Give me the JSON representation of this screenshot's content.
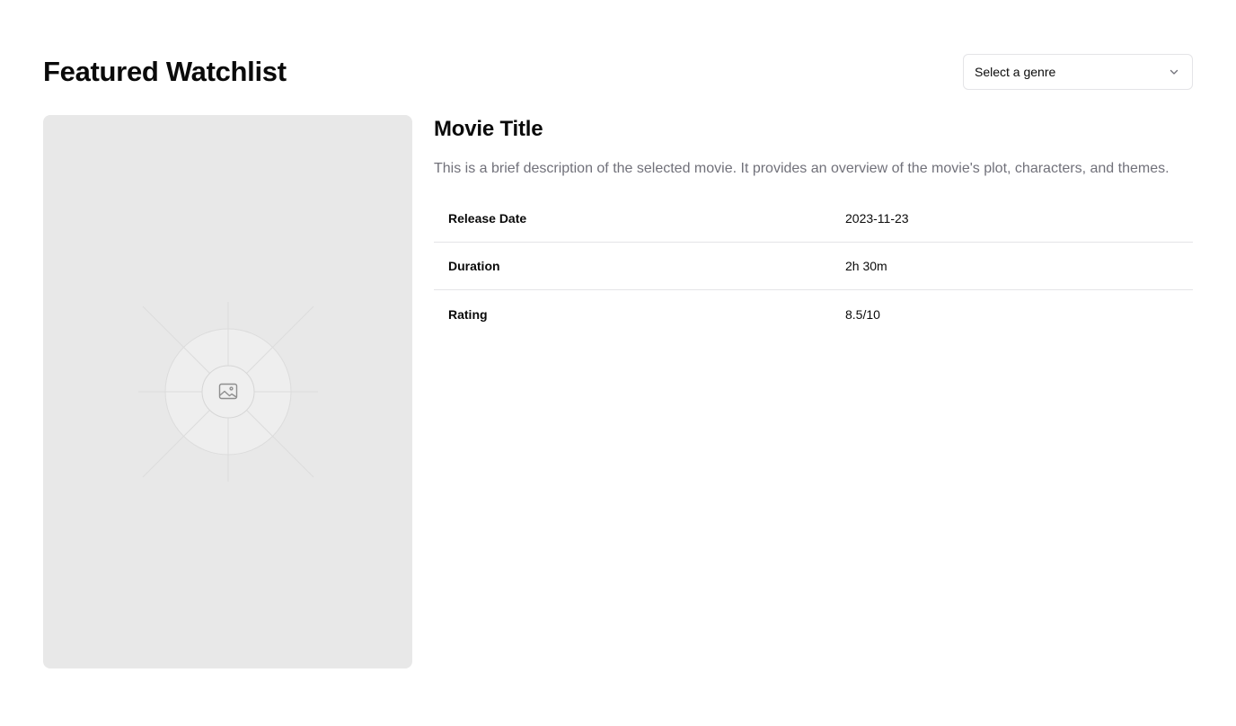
{
  "header": {
    "title": "Featured Watchlist",
    "genre_select": {
      "placeholder": "Select a genre"
    }
  },
  "movie": {
    "title": "Movie Title",
    "description": "This is a brief description of the selected movie. It provides an overview of the movie's plot, characters, and themes.",
    "poster_icon": "image-placeholder-icon",
    "info": [
      {
        "label": "Release Date",
        "value": "2023-11-23"
      },
      {
        "label": "Duration",
        "value": "2h 30m"
      },
      {
        "label": "Rating",
        "value": "8.5/10"
      }
    ]
  }
}
